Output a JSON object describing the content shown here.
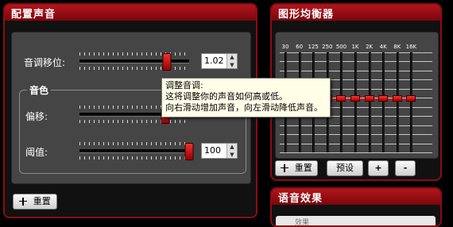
{
  "sound_panel": {
    "title": "配置声音",
    "pitch": {
      "label": "音调移位:",
      "value": "1.02",
      "level": 0.8
    },
    "timbre": {
      "title": "音色",
      "offset": {
        "label": "偏移:",
        "level": 0.78
      },
      "threshold": {
        "label": "阈值:",
        "value": "100",
        "level": 1.0
      }
    },
    "reset_label": "重置"
  },
  "tooltip": {
    "title": "调整音调:",
    "line1": "这将调整你的声音如何高或低。",
    "line2": "向右滑动增加声音，向左滑动降低声音。"
  },
  "eq_panel": {
    "title": "图形均衡器",
    "bands": [
      "30",
      "60",
      "125",
      "250",
      "500",
      "1K",
      "2K",
      "4K",
      "8K",
      "16K"
    ],
    "levels": [
      0,
      0,
      0,
      0,
      0,
      0,
      0,
      0,
      0,
      0
    ],
    "reset_label": "重置",
    "preset_label": "预设",
    "add_label": "+",
    "remove_label": "-"
  },
  "effects_panel": {
    "title": "语音效果",
    "item_label": "效果"
  },
  "colors": {
    "panel_red": "#8a0d14",
    "slider_thumb": "#cc2222",
    "tooltip_bg": "#ffffe8"
  }
}
